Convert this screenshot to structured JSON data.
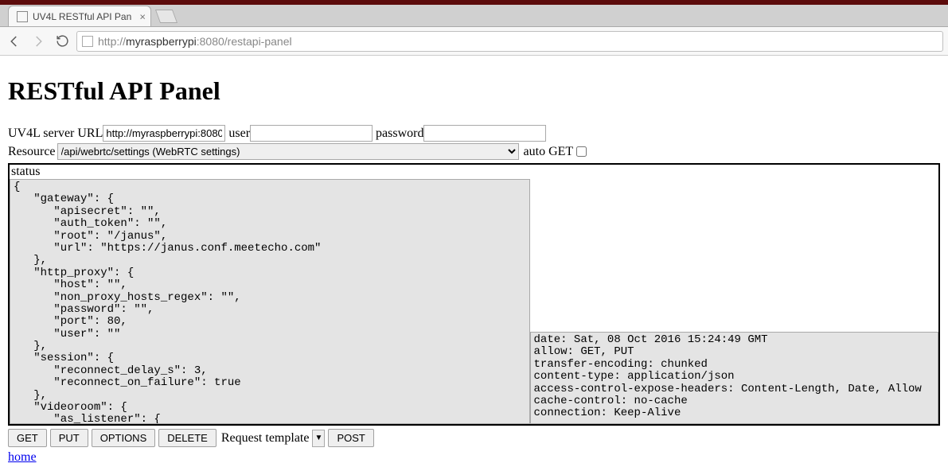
{
  "browser": {
    "tab_title": "UV4L RESTful API Pan",
    "url_display_prefix": "http://",
    "url_display_host": "myraspberrypi",
    "url_display_suffix": ":8080/restapi-panel"
  },
  "page": {
    "heading": "RESTful API Panel",
    "server_url_label": "UV4L server URL",
    "server_url_value": "http://myraspberrypi:8080",
    "user_label": "user",
    "user_value": "",
    "password_label": "password",
    "password_value": "",
    "resource_label": "Resource",
    "resource_selected": "/api/webrtc/settings (WebRTC settings)",
    "auto_get_label": "auto GET",
    "auto_get_checked": false,
    "status_label": "status",
    "request_template_label": "Request template",
    "home_link": "home"
  },
  "buttons": {
    "get": "GET",
    "put": "PUT",
    "options": "OPTIONS",
    "delete": "DELETE",
    "post": "POST"
  },
  "response_body": "{\n   \"gateway\": {\n      \"apisecret\": \"\",\n      \"auth_token\": \"\",\n      \"root\": \"/janus\",\n      \"url\": \"https://janus.conf.meetecho.com\"\n   },\n   \"http_proxy\": {\n      \"host\": \"\",\n      \"non_proxy_hosts_regex\": \"\",\n      \"password\": \"\",\n      \"port\": 80,\n      \"user\": \"\"\n   },\n   \"session\": {\n      \"reconnect_delay_s\": 3,\n      \"reconnect_on_failure\": true\n   },\n   \"videoroom\": {\n      \"as_listener\": {",
  "response_headers": "date: Sat, 08 Oct 2016 15:24:49 GMT\nallow: GET, PUT\ntransfer-encoding: chunked\ncontent-type: application/json\naccess-control-expose-headers: Content-Length, Date, Allow\ncache-control: no-cache\nconnection: Keep-Alive"
}
